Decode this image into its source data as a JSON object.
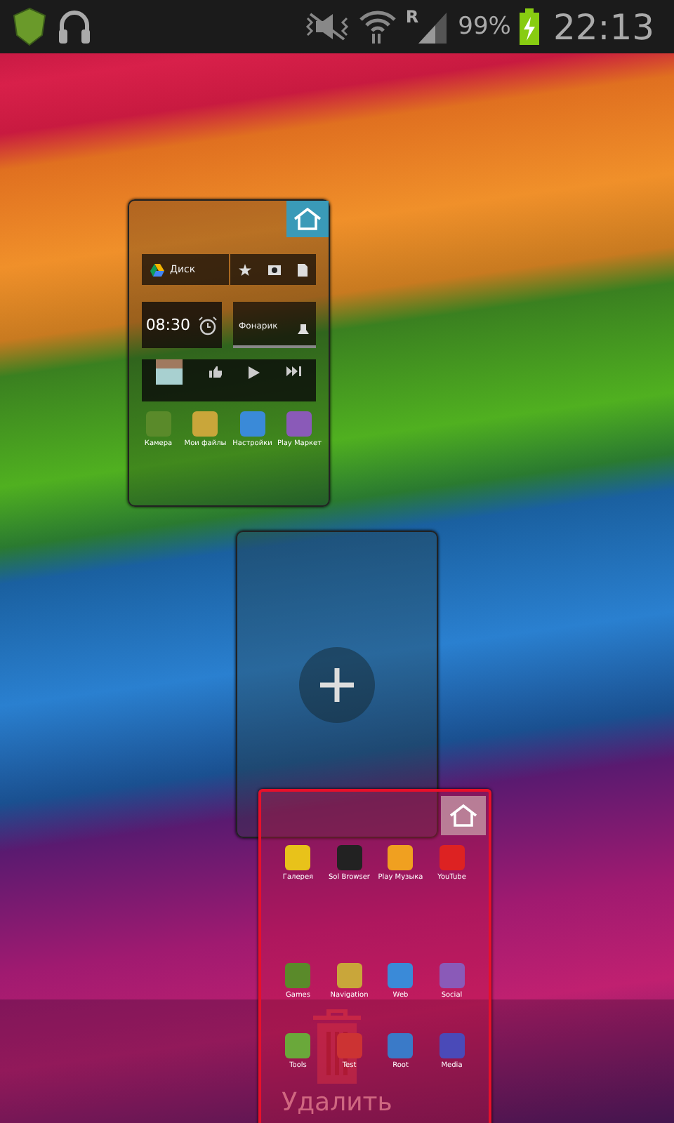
{
  "status_bar": {
    "roaming": "R",
    "battery": "99%",
    "time": "22:13"
  },
  "pages": [
    {
      "kind": "widgets",
      "home": true,
      "dragging": false,
      "drive": "Диск",
      "clock": "08:30",
      "flashlight": "Фонарик",
      "apps": [
        "Камера",
        "Мои файлы",
        "Настройки",
        "Play Маркет"
      ]
    },
    {
      "kind": "add",
      "dragging": false
    },
    {
      "kind": "apps",
      "home": false,
      "dragging": true,
      "apps": [
        "Галерея",
        "Sol Browser",
        "Play Музыка",
        "YouTube"
      ],
      "folders": [
        "Games",
        "Navigation",
        "Web",
        "Social",
        "Tools",
        "Test",
        "Root",
        "Media"
      ]
    }
  ],
  "delete_zone": {
    "label": "Удалить"
  }
}
